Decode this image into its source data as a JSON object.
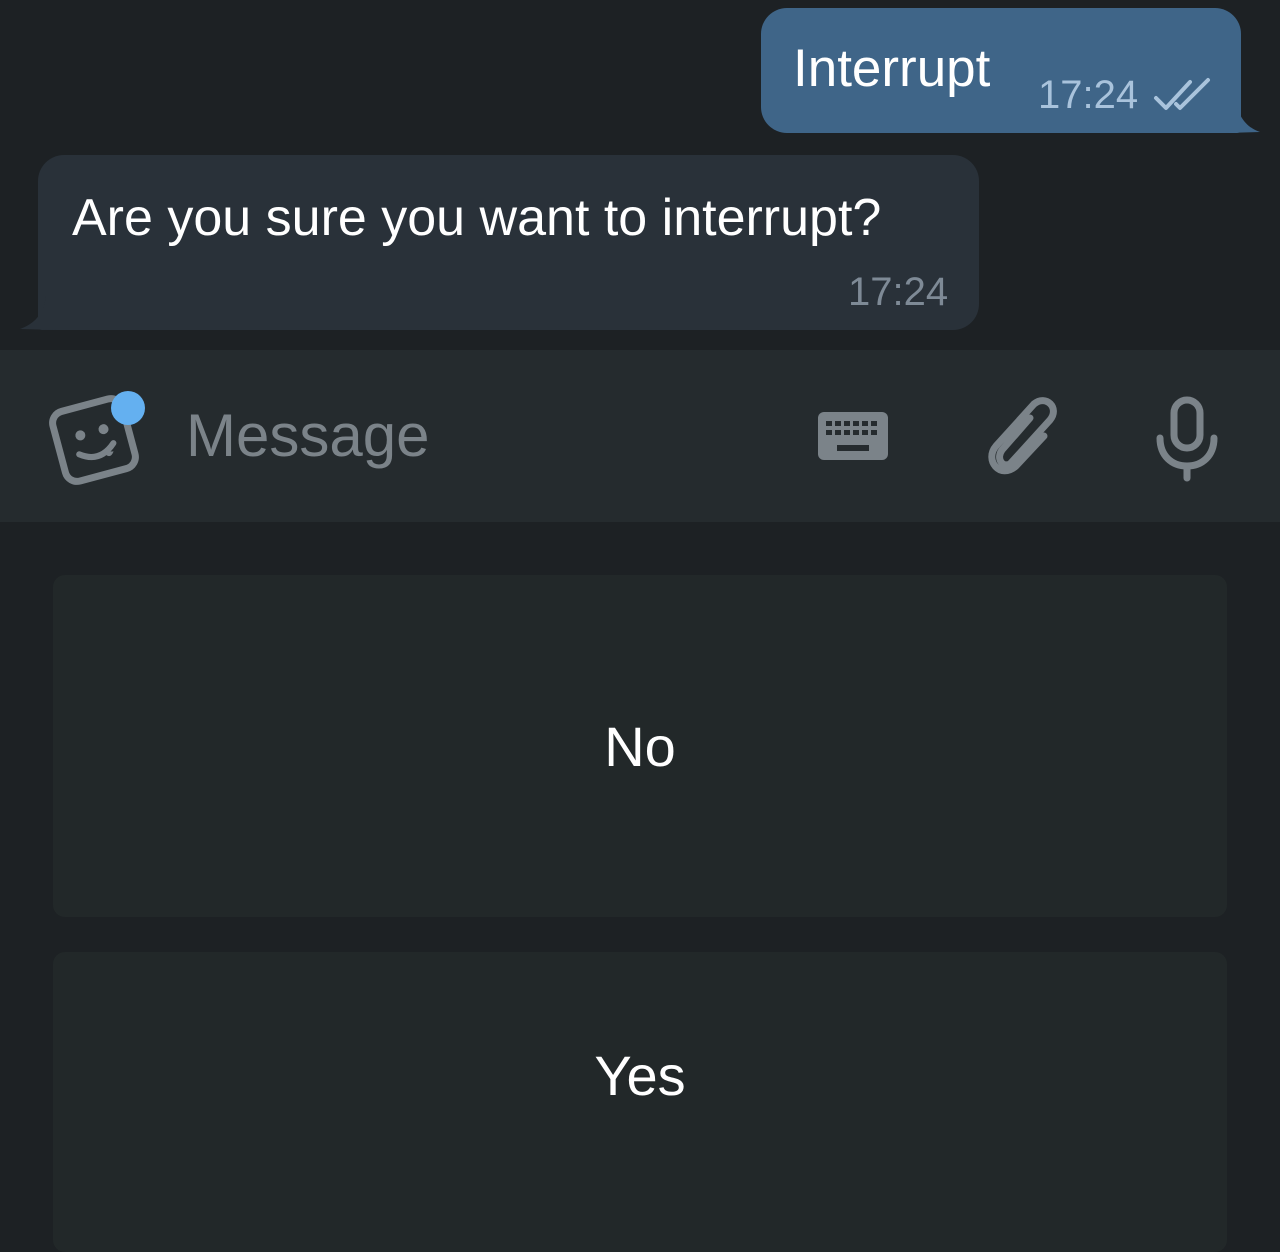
{
  "messages": {
    "outgoing": {
      "text": "Interrupt",
      "time": "17:24",
      "status_icon": "double-check-icon"
    },
    "incoming": {
      "text": "Are you sure you want to interrupt?",
      "time": "17:24"
    }
  },
  "input_bar": {
    "placeholder": "Message",
    "icons": [
      "sticker-icon",
      "keyboard-icon",
      "attach-icon",
      "mic-icon"
    ]
  },
  "reply_keyboard": {
    "buttons": [
      {
        "label": "No"
      },
      {
        "label": "Yes"
      }
    ]
  },
  "colors": {
    "background": "#1d2124",
    "outgoing_bubble": "#3f6588",
    "incoming_bubble": "#293139",
    "input_bar": "#252b2e",
    "keyboard_button": "#222829",
    "accent_dot": "#64b0f0"
  }
}
